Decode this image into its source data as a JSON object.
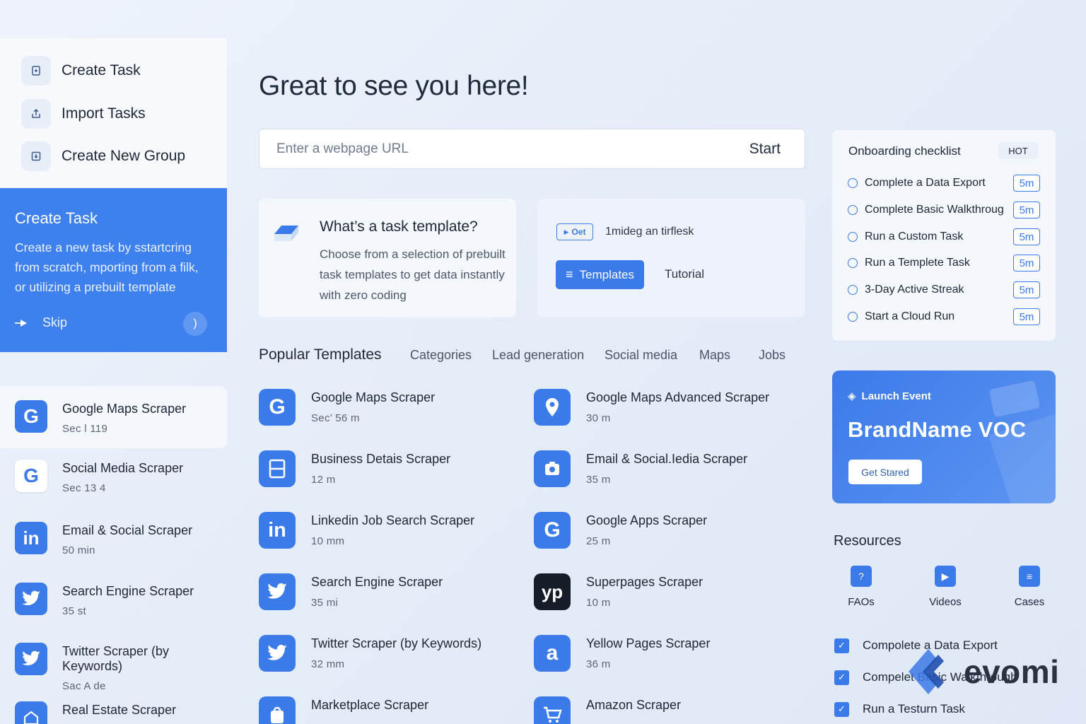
{
  "quick_actions": [
    {
      "label": "Create Task",
      "icon": "file-plus-icon"
    },
    {
      "label": "Import Tasks",
      "icon": "upload-icon"
    },
    {
      "label": "Create New Group",
      "icon": "download-icon"
    }
  ],
  "promo": {
    "title": "Create Task",
    "body": "Create a new task by sstartcring from scratch, mporting from a filk, or utilizing a prebuilt template",
    "skip": "Skip",
    "next_glyph": ")"
  },
  "left_list": [
    {
      "title": "Google Maps Scraper",
      "meta": "Sec l 119",
      "icon": "G",
      "style": "blue"
    },
    {
      "title": "Social Media Scraper",
      "meta": "Sec 13 4",
      "icon": "G",
      "style": "white"
    },
    {
      "title": "Email & Social Scraper",
      "meta": "50 min",
      "icon": "in",
      "style": "blue"
    },
    {
      "title": "Search Engine Scraper",
      "meta": "35 st",
      "icon": "bird",
      "style": "blue"
    },
    {
      "title": "Twitter Scraper (by Keywords)",
      "meta": "Sac  A de",
      "icon": "bird",
      "style": "blue"
    },
    {
      "title": "Real Estate Scraper",
      "meta": "",
      "icon": "house",
      "style": "blue"
    }
  ],
  "main": {
    "greeting": "Great to see you here!",
    "url_placeholder": "Enter a webpage URL",
    "start_label": "Start",
    "template_card": {
      "title": "What’s a task template?",
      "desc": "Choose from a selection of prebuilt task templates to get data instantly with zero coding"
    },
    "guide_card": {
      "badge": "Oet",
      "text": "1mideg an tirflesk",
      "templates_label": "Templates",
      "tutorial_label": "Tutorial"
    },
    "popular_title": "Popular Templates",
    "tabs": [
      "Categories",
      "Lead generation",
      "Social media",
      "Maps",
      "Jobs"
    ],
    "templates_left": [
      {
        "title": "Google Maps Scraper",
        "meta": "Sec’ 56 m",
        "icon": "G"
      },
      {
        "title": "Business Detais Scraper",
        "meta": "12 m",
        "icon": "doc"
      },
      {
        "title": "Linkedin Job Search Scraper",
        "meta": "10 mm",
        "icon": "in"
      },
      {
        "title": "Search Engine Scraper",
        "meta": "35 mi",
        "icon": "bird"
      },
      {
        "title": "Twitter Scraper (by Keywords)",
        "meta": "32 mm",
        "icon": "bird"
      },
      {
        "title": "Marketplace Scraper",
        "meta": "",
        "icon": "bag"
      }
    ],
    "templates_right": [
      {
        "title": "Google Maps Advanced Scraper",
        "meta": "30 m",
        "icon": "pin"
      },
      {
        "title": "Email & Social.Iedia Scraper",
        "meta": "35 m",
        "icon": "camera"
      },
      {
        "title": "Google Apps Scraper",
        "meta": "25 m",
        "icon": "G"
      },
      {
        "title": "Superpages Scraper",
        "meta": "10 m",
        "icon": "yp"
      },
      {
        "title": "Yellow Pages Scraper",
        "meta": "36 m",
        "icon": "a"
      },
      {
        "title": "Amazon Scraper",
        "meta": "",
        "icon": "cart"
      }
    ]
  },
  "checklist": {
    "title": "Onboarding checklist",
    "badge": "HOT",
    "items": [
      {
        "label": "Complete a Data Export",
        "time": "5m"
      },
      {
        "label": "Complete Basic Walkthroug",
        "time": "5m"
      },
      {
        "label": "Run a Custom Task",
        "time": "5m"
      },
      {
        "label": "Run a Templete Task",
        "time": "5m"
      },
      {
        "label": "3-Day Active Streak",
        "time": "5m"
      },
      {
        "label": "Start a Cloud Run",
        "time": "5m"
      }
    ]
  },
  "event": {
    "tag": "Launch Event",
    "title": "BrandName VOC",
    "button": "Get Stared"
  },
  "resources": {
    "title": "Resources",
    "items": [
      {
        "label": "FAOs",
        "icon": "question-icon"
      },
      {
        "label": "Videos",
        "icon": "play-icon"
      },
      {
        "label": "Cases",
        "icon": "list-icon"
      }
    ]
  },
  "completed": [
    {
      "label": "Compolete a Data Export"
    },
    {
      "label": "Compelet Basic Walkthrough"
    },
    {
      "label": "Run a Testurn Task"
    }
  ],
  "watermark": "evomi",
  "colors": {
    "accent": "#3b7ae9",
    "promo_bg": "#3d80ee",
    "background": "#e7eef9"
  }
}
